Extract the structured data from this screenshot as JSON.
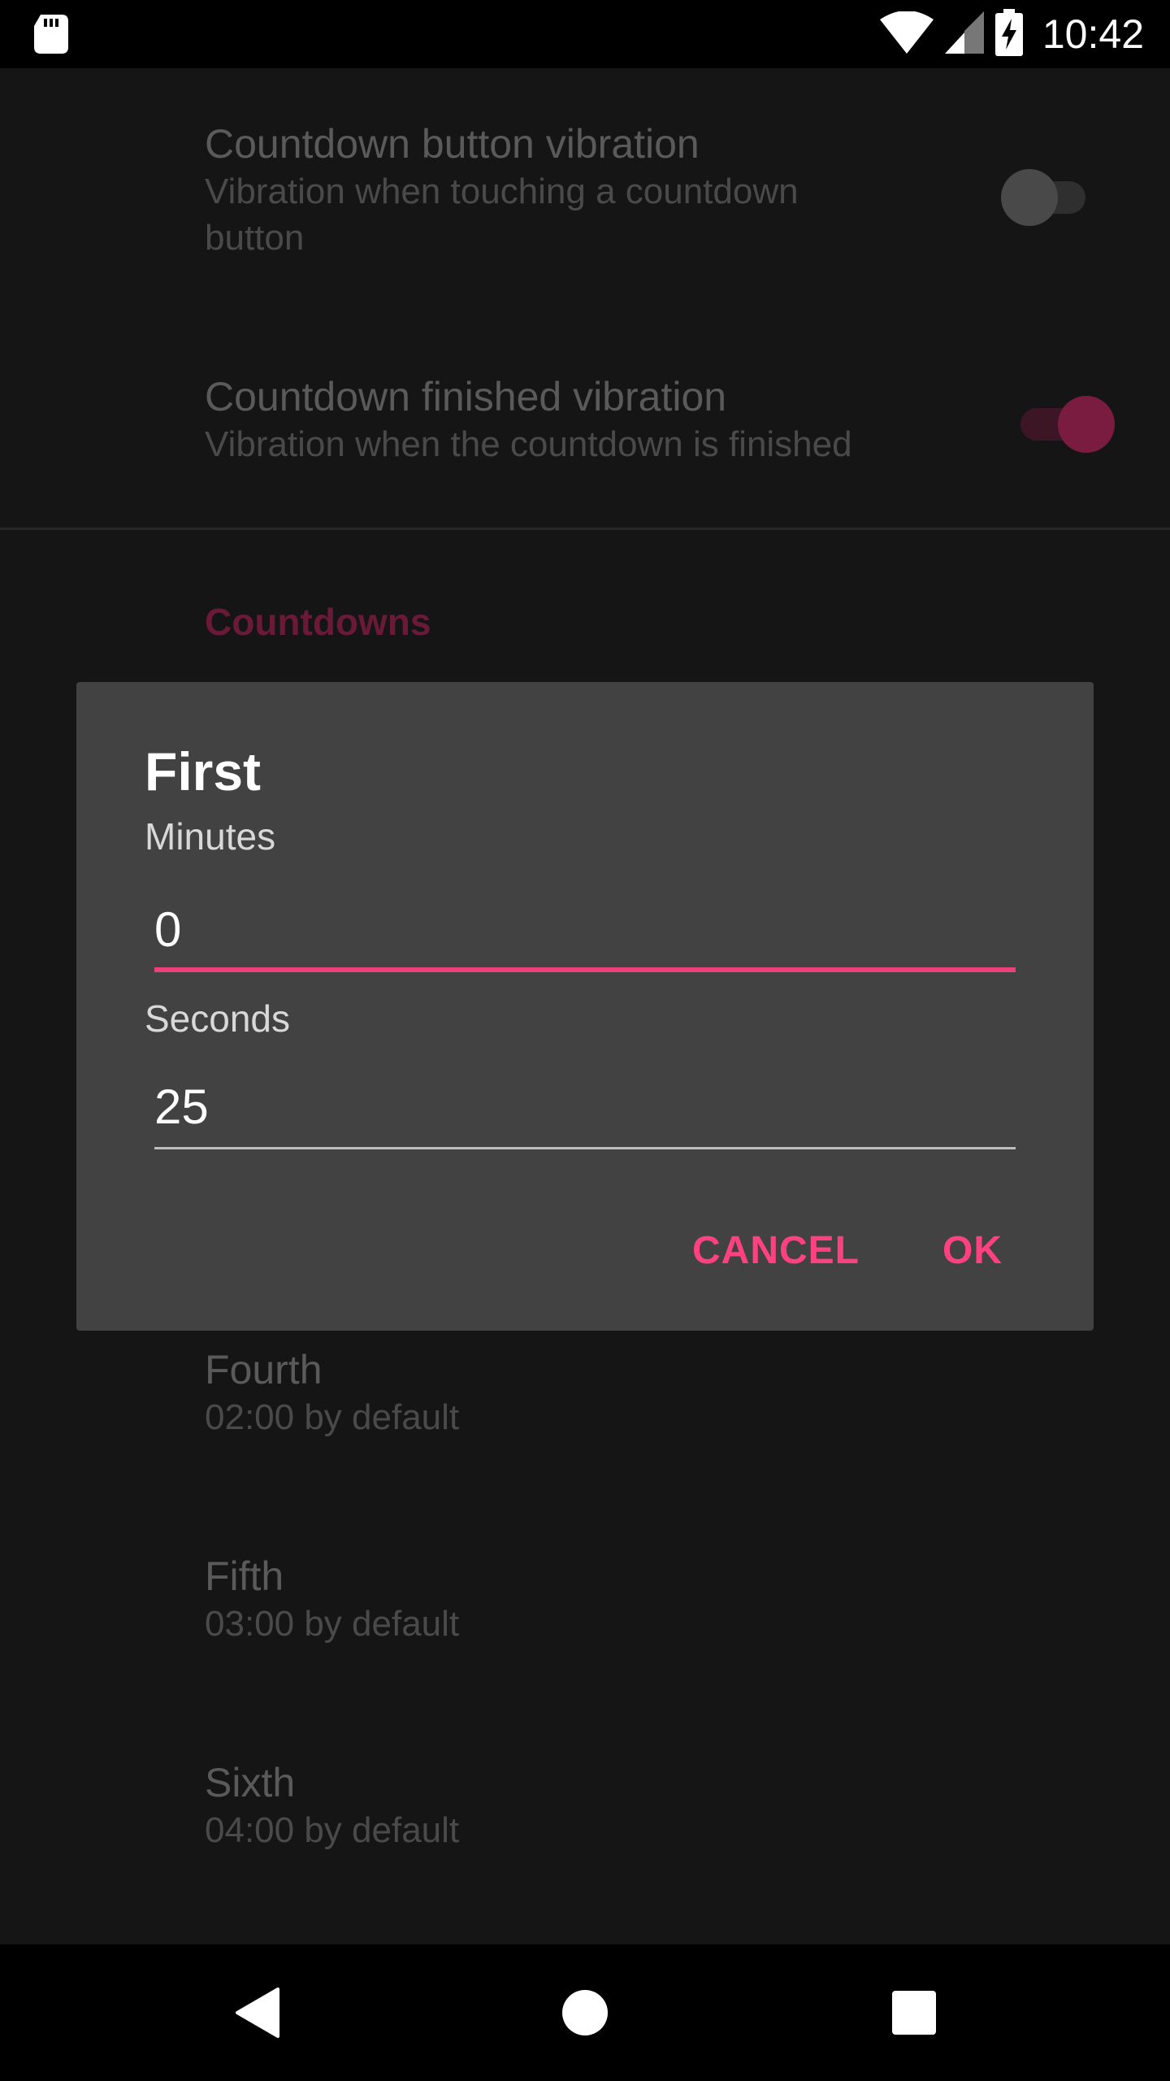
{
  "status_bar": {
    "time": "10:42",
    "icons": [
      "sd-card-icon",
      "wifi-icon",
      "signal-icon",
      "battery-charging-icon"
    ]
  },
  "settings": {
    "button_vibration": {
      "title": "Countdown button vibration",
      "summary_line1": "Vibration when touching a countdown",
      "summary_line2": "button",
      "enabled": false
    },
    "finished_vibration": {
      "title": "Countdown finished vibration",
      "summary": "Vibration when the countdown is finished",
      "enabled": true
    },
    "category_title": "Countdowns",
    "countdowns": [
      {
        "title": "Fourth",
        "summary": "02:00 by default"
      },
      {
        "title": "Fifth",
        "summary": "03:00 by default"
      },
      {
        "title": "Sixth",
        "summary": "04:00 by default"
      }
    ]
  },
  "dialog": {
    "title": "First",
    "minutes_label": "Minutes",
    "minutes_value": "0",
    "seconds_label": "Seconds",
    "seconds_value": "25",
    "cancel_label": "CANCEL",
    "ok_label": "OK"
  },
  "colors": {
    "accent": "#FF4081",
    "focused_underline": "#EC407A",
    "dialog_bg": "#424242",
    "screen_bg": "#151515"
  },
  "nav_bar": {
    "icons": [
      "back-icon",
      "home-icon",
      "recents-icon"
    ]
  }
}
